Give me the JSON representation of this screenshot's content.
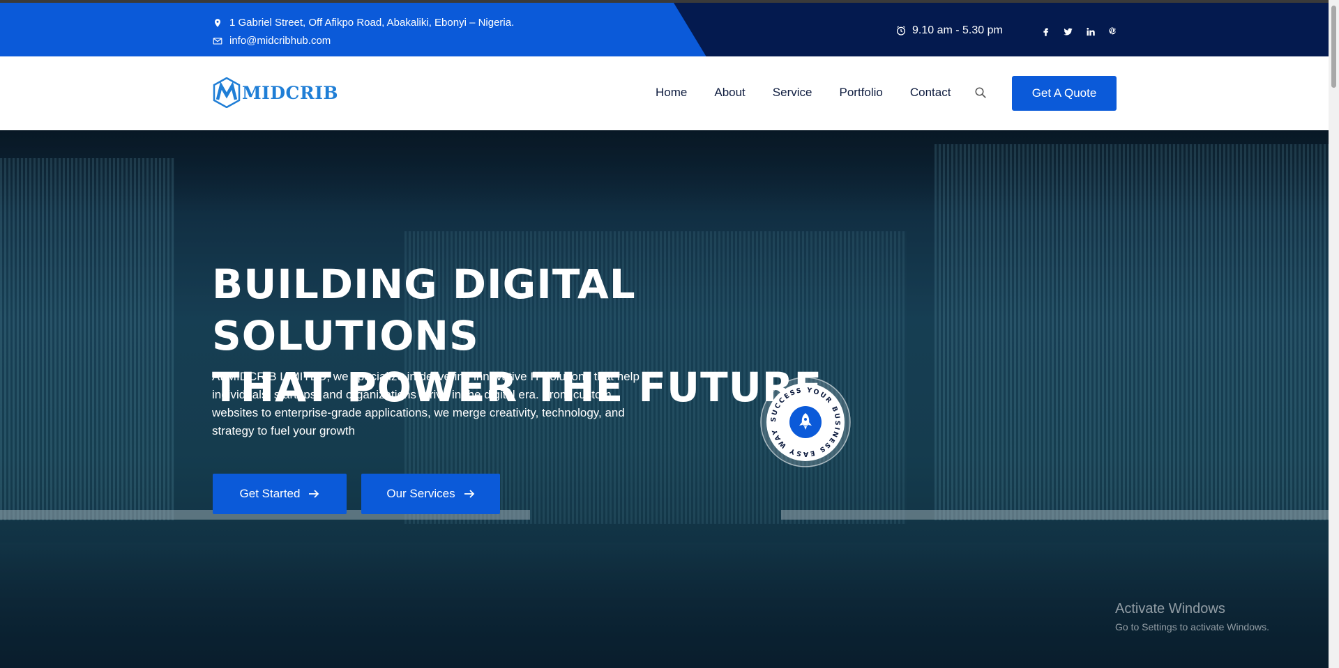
{
  "topbar": {
    "address": "1 Gabriel Street, Off Afikpo Road, Abakaliki, Ebonyi – Nigeria.",
    "email": "info@midcribhub.com",
    "hours": "9.10 am - 5.30 pm",
    "socials": [
      "facebook-icon",
      "twitter-icon",
      "linkedin-icon",
      "pinterest-icon"
    ]
  },
  "header": {
    "logo_text": "MIDCRIB",
    "nav": [
      "Home",
      "About",
      "Service",
      "Portfolio",
      "Contact"
    ],
    "quote_label": "Get A Quote"
  },
  "hero": {
    "title_line1": "BUILDING DIGITAL SOLUTIONS",
    "title_line2": "THAT POWER THE FUTURE",
    "description": "At MIDCRIB LIMITED, we specialize in delivering innovative IT solutions that help individuals, startups, and organizations thrive in the digital era. From custom websites to enterprise-grade applications, we merge creativity, technology, and strategy to fuel your growth",
    "primary_btn": "Get Started",
    "secondary_btn": "Our Services",
    "badge_text": "SUCCESS YOUR BUSINESS EASY WAY TO "
  },
  "watermark": {
    "line1": "Activate Windows",
    "line2": "Go to Settings to activate Windows."
  },
  "colors": {
    "primary": "#0b5ad9",
    "dark": "#041a4f"
  }
}
